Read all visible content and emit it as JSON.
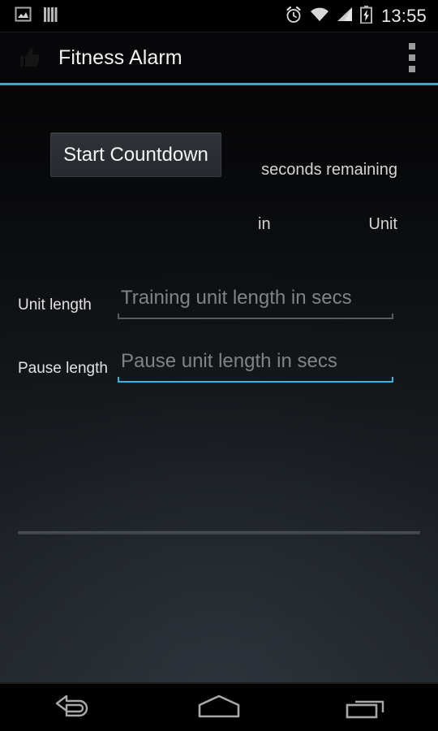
{
  "status_bar": {
    "time": "13:55",
    "left_icons": [
      {
        "name": "gallery-image-icon"
      },
      {
        "name": "sim-card-icon"
      }
    ],
    "right_icons": [
      {
        "name": "alarm-clock-icon"
      },
      {
        "name": "wifi-icon"
      },
      {
        "name": "cellular-signal-icon"
      },
      {
        "name": "battery-charging-icon"
      }
    ]
  },
  "action_bar": {
    "logo_icon": "thumbs-up-icon",
    "title": "Fitness Alarm",
    "overflow_icon": "overflow-menu-icon",
    "accent_color": "#3fa3cc"
  },
  "main": {
    "start_button_label": "Start Countdown",
    "seconds_remaining_value": "",
    "seconds_remaining_label": "seconds remaining",
    "current_unit_value": "",
    "in_label": "in",
    "total_unit_value": "",
    "unit_label": "Unit",
    "fields": [
      {
        "label": "Unit length",
        "value": "",
        "placeholder": "Training unit length in secs",
        "focused": false,
        "underline_color": "#565b5f"
      },
      {
        "label": "Pause length",
        "value": "",
        "placeholder": "Pause unit length in secs",
        "focused": true,
        "underline_color": "#33b5e5"
      }
    ]
  },
  "nav_bar": {
    "buttons": [
      {
        "name": "back-button"
      },
      {
        "name": "home-button"
      },
      {
        "name": "recents-button"
      }
    ]
  }
}
